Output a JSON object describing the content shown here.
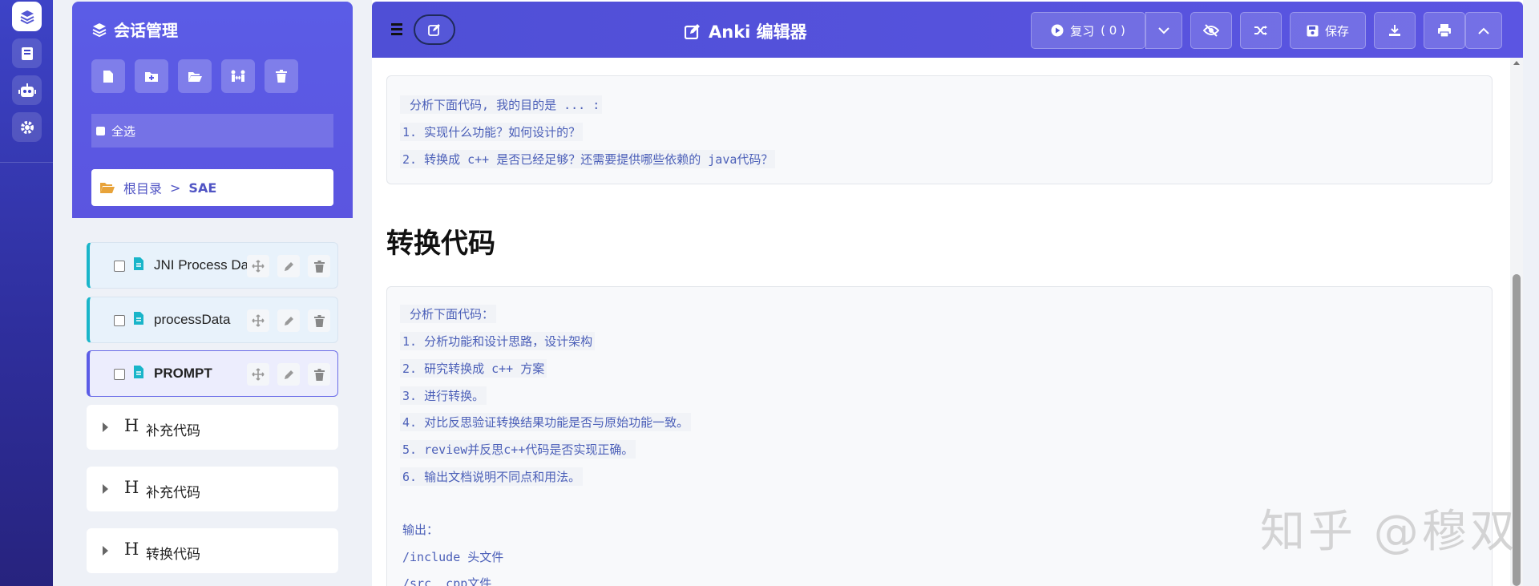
{
  "rail": {
    "icons": [
      "layers-icon",
      "book-icon",
      "robot-icon",
      "gear-icon"
    ]
  },
  "session": {
    "title": "会话管理",
    "toolbar": [
      "new-file-icon",
      "new-folder-icon",
      "open-folder-icon",
      "people-arrows-icon",
      "trash-icon"
    ],
    "select_all": "全选",
    "breadcrumb": {
      "root": "根目录",
      "sep": ">",
      "current": "SAE"
    },
    "files": [
      {
        "name": "JNI Process Data",
        "active": false
      },
      {
        "name": "processData",
        "active": false
      },
      {
        "name": "PROMPT",
        "active": true
      }
    ],
    "headings": [
      {
        "mark": "H",
        "label": "补充代码"
      },
      {
        "mark": "H",
        "label": "补充代码"
      },
      {
        "mark": "H",
        "label": "转换代码"
      }
    ]
  },
  "editor": {
    "title": "Anki 编辑器",
    "review_label": "复习",
    "review_count": "( 0 )",
    "save_label": "保存"
  },
  "content": {
    "block1": [
      " 分析下面代码, 我的目的是 ... :",
      "1. 实现什么功能？如何设计的？",
      "2. 转换成 c++ 是否已经足够？还需要提供哪些依赖的 java代码？"
    ],
    "section_title": "转换代码",
    "block2": [
      " 分析下面代码：",
      "1. 分析功能和设计思路，设计架构",
      "2. 研究转换成 c++ 方案",
      "3. 进行转换。",
      "4. 对比反思验证转换结果功能是否与原始功能一致。",
      "5. review并反思c++代码是否实现正确。",
      "6. 输出文档说明不同点和用法。",
      "",
      "输出：",
      "/include 头文件",
      "/src  cpp文件"
    ]
  },
  "watermark": "知乎 @穆双",
  "colors": {
    "accent": "#5b5ce6",
    "rail": "#2f2f9e",
    "file_border": "#19b5c9"
  }
}
